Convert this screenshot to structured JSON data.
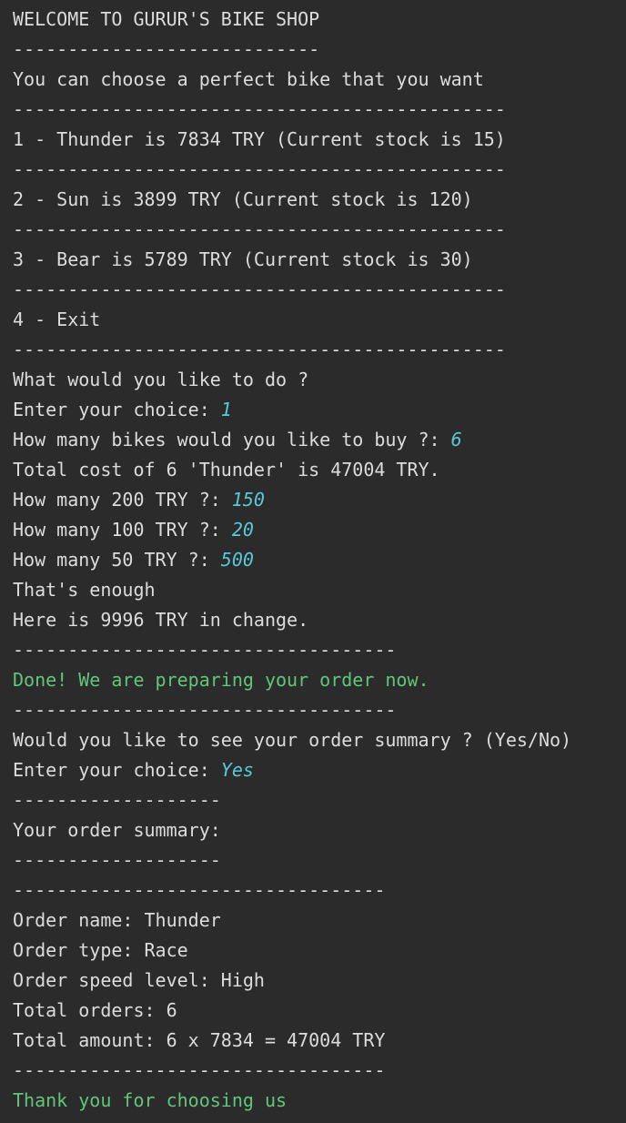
{
  "lines": [
    {
      "text": "WELCOME TO GURUR'S BIKE SHOP"
    },
    {
      "text": "----------------------------"
    },
    {
      "text": "You can choose a perfect bike that you want"
    },
    {
      "text": "---------------------------------------------"
    },
    {
      "text": "1 - Thunder is 7834 TRY (Current stock is 15)"
    },
    {
      "text": "---------------------------------------------"
    },
    {
      "text": "2 - Sun is 3899 TRY (Current stock is 120)"
    },
    {
      "text": "---------------------------------------------"
    },
    {
      "text": "3 - Bear is 5789 TRY (Current stock is 30)"
    },
    {
      "text": "---------------------------------------------"
    },
    {
      "text": "4 - Exit"
    },
    {
      "text": "---------------------------------------------"
    },
    {
      "text": "What would you like to do ?"
    },
    {
      "text": "Enter your choice: ",
      "input": "1"
    },
    {
      "text": "How many bikes would you like to buy ?: ",
      "input": "6"
    },
    {
      "text": "Total cost of 6 'Thunder' is 47004 TRY."
    },
    {
      "text": "How many 200 TRY ?: ",
      "input": "150"
    },
    {
      "text": "How many 100 TRY ?: ",
      "input": "20"
    },
    {
      "text": "How many 50 TRY ?: ",
      "input": "500"
    },
    {
      "text": "That's enough"
    },
    {
      "text": "Here is 9996 TRY in change."
    },
    {
      "text": "-----------------------------------"
    },
    {
      "text": "Done! We are preparing your order now.",
      "color": "green"
    },
    {
      "text": "-----------------------------------"
    },
    {
      "text": "Would you like to see your order summary ? (Yes/No)"
    },
    {
      "text": "Enter your choice: ",
      "input": "Yes"
    },
    {
      "text": "-------------------"
    },
    {
      "text": "Your order summary:"
    },
    {
      "text": "-------------------"
    },
    {
      "text": "----------------------------------"
    },
    {
      "text": "Order name: Thunder"
    },
    {
      "text": "Order type: Race"
    },
    {
      "text": "Order speed level: High"
    },
    {
      "text": "Total orders: 6"
    },
    {
      "text": "Total amount: 6 x 7834 = 47004 TRY"
    },
    {
      "text": "----------------------------------"
    },
    {
      "text": "Thank you for choosing us",
      "color": "green"
    }
  ],
  "colors": {
    "background": "#2b2b2b",
    "text": "#dcdcdc",
    "success": "#62c57a",
    "user_input": "#58c9d8"
  }
}
